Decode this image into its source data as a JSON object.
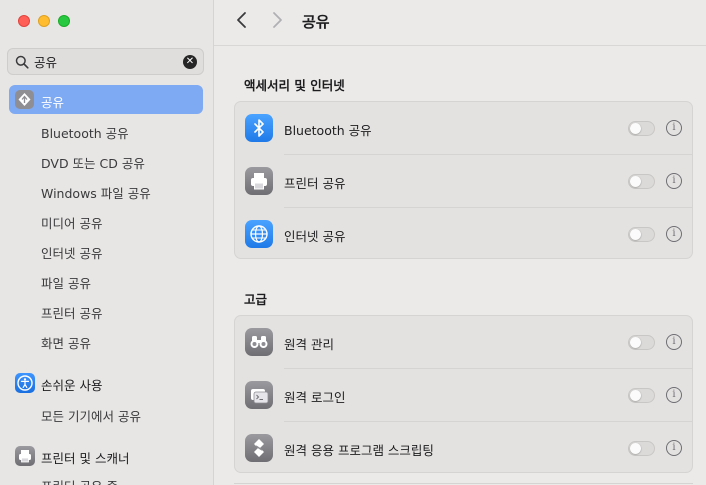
{
  "sidebar": {
    "search_value": "공유",
    "selected_label": "공유",
    "sub_items": [
      "Bluetooth 공유",
      "DVD 또는 CD 공유",
      "Windows 파일 공유",
      "미디어 공유",
      "인터넷 공유",
      "파일 공유",
      "프린터 공유",
      "화면 공유"
    ],
    "group_accessibility": "손쉬운 사용",
    "accessibility_sub": "모든 기기에서 공유",
    "group_printers": "프린터 및 스캐너",
    "printers_sub": "프린터 공유 중"
  },
  "header": {
    "title": "공유"
  },
  "sections": [
    {
      "title": "액세서리 및 인터넷",
      "rows": [
        {
          "label": "Bluetooth 공유",
          "icon": "bluetooth-icon",
          "enabled": false
        },
        {
          "label": "프린터 공유",
          "icon": "printer-icon",
          "enabled": false
        },
        {
          "label": "인터넷 공유",
          "icon": "globe-icon",
          "enabled": false
        }
      ]
    },
    {
      "title": "고급",
      "rows": [
        {
          "label": "원격 관리",
          "icon": "binoculars-icon",
          "enabled": false
        },
        {
          "label": "원격 로그인",
          "icon": "terminal-icon",
          "enabled": false
        },
        {
          "label": "원격 응용 프로그램 스크립팅",
          "icon": "script-icon",
          "enabled": false
        }
      ]
    }
  ],
  "colors": {
    "selection": "#7ea9f3",
    "accent_blue": "#1f7ae8",
    "traffic_red": "#ff5f57",
    "traffic_yellow": "#febc2e",
    "traffic_green": "#28c840"
  }
}
